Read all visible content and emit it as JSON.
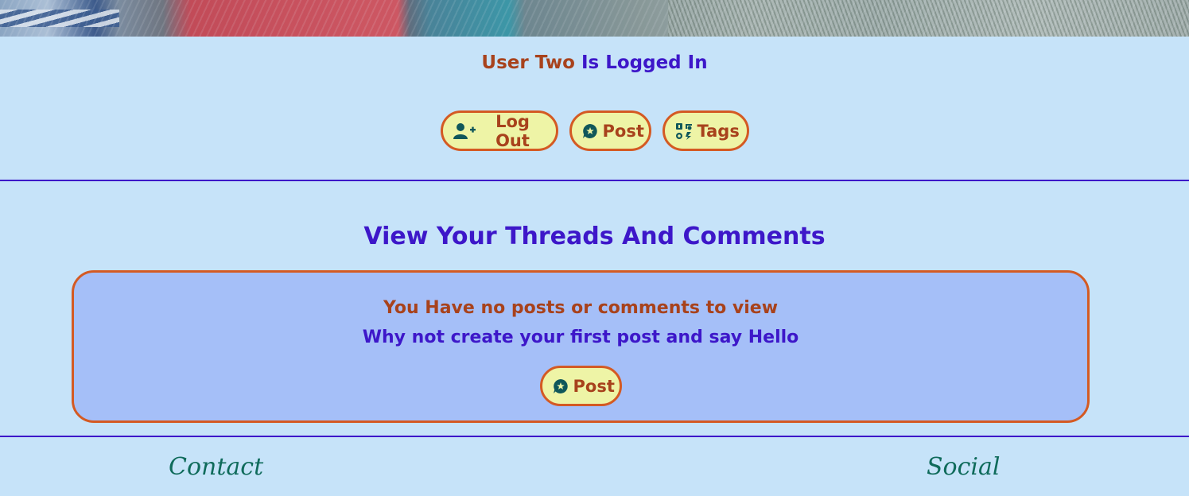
{
  "login": {
    "user": "User Two",
    "status": "Is Logged In"
  },
  "nav": {
    "logout_label": "Log Out",
    "post_label": "Post",
    "tags_label": "Tags"
  },
  "section": {
    "title": "View Your Threads And Comments"
  },
  "panel": {
    "empty_message": "You Have no posts or comments to view",
    "prompt_message": "Why not create your first post and say Hello",
    "post_button_label": "Post"
  },
  "footer": {
    "contact_heading": "Contact",
    "social_heading": "Social"
  },
  "icons": {
    "logout": "user-plus-icon",
    "post": "comment-star-icon",
    "tags": "tags-grid-icon"
  },
  "colors": {
    "background": "#c6e3f9",
    "accent_purple": "#3d17c9",
    "accent_rust": "#a8421c",
    "button_fill": "#eef4a6",
    "button_border": "#d45a23",
    "icon_teal": "#10575a",
    "panel_fill": "#a5bff8",
    "footer_green": "#0f6b5b"
  }
}
